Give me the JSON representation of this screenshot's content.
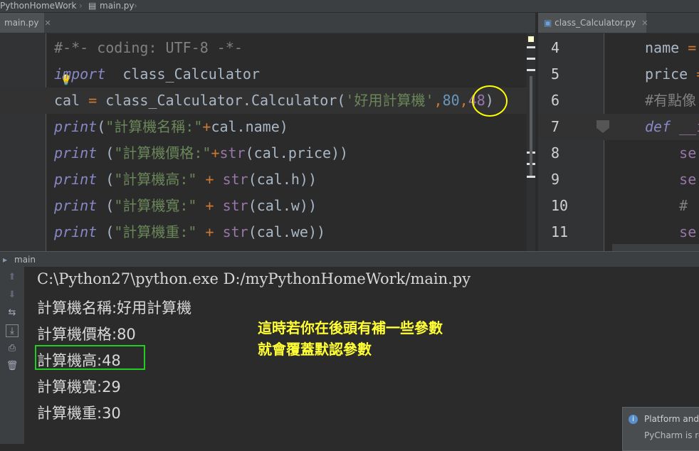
{
  "breadcrumb": {
    "project": "PythonHomeWork",
    "file": "main.py"
  },
  "editor_left": {
    "tab": {
      "label": "main.py"
    },
    "lines": [
      {
        "tokens": [
          {
            "t": "#-*- coding: UTF-8 -*-",
            "c": "cmt"
          }
        ]
      },
      {
        "tokens": [
          {
            "t": "import",
            "c": "it"
          },
          {
            "t": "  class_Calculator",
            "c": ""
          }
        ]
      },
      {
        "tokens": [
          {
            "t": "cal ",
            "c": ""
          },
          {
            "t": "=",
            "c": "op"
          },
          {
            "t": " class_Calculator.Calculator(",
            "c": ""
          },
          {
            "t": "'好用計算機'",
            "c": "str"
          },
          {
            "t": ",",
            "c": "kw"
          },
          {
            "t": "80",
            "c": "num"
          },
          {
            "t": ",",
            "c": "kw"
          },
          {
            "t": "48",
            "c": "purple"
          },
          {
            "t": ")",
            "c": ""
          }
        ]
      },
      {
        "tokens": [
          {
            "t": "print",
            "c": "it"
          },
          {
            "t": "(",
            "c": ""
          },
          {
            "t": "\"計算機名稱:\"",
            "c": "str"
          },
          {
            "t": "+",
            "c": "op"
          },
          {
            "t": "cal.name)",
            "c": ""
          }
        ]
      },
      {
        "tokens": [
          {
            "t": "print",
            "c": "it"
          },
          {
            "t": " (",
            "c": ""
          },
          {
            "t": "\"計算機價格:\"",
            "c": "str"
          },
          {
            "t": "+",
            "c": "op"
          },
          {
            "t": "str",
            "c": "purple"
          },
          {
            "t": "(cal.price))",
            "c": ""
          }
        ]
      },
      {
        "tokens": [
          {
            "t": "print",
            "c": "it"
          },
          {
            "t": " (",
            "c": ""
          },
          {
            "t": "\"計算機高:\"",
            "c": "str"
          },
          {
            "t": " + ",
            "c": "op"
          },
          {
            "t": "str",
            "c": "purple"
          },
          {
            "t": "(cal.h))",
            "c": ""
          }
        ]
      },
      {
        "tokens": [
          {
            "t": "print",
            "c": "it"
          },
          {
            "t": " (",
            "c": ""
          },
          {
            "t": "\"計算機寬:\"",
            "c": "str"
          },
          {
            "t": " + ",
            "c": "op"
          },
          {
            "t": "str",
            "c": "purple"
          },
          {
            "t": "(cal.w))",
            "c": ""
          }
        ]
      },
      {
        "tokens": [
          {
            "t": "print",
            "c": "it"
          },
          {
            "t": " (",
            "c": ""
          },
          {
            "t": "\"計算機重:\"",
            "c": "str"
          },
          {
            "t": " + ",
            "c": "op"
          },
          {
            "t": "str",
            "c": "purple"
          },
          {
            "t": "(cal.we))",
            "c": ""
          }
        ]
      }
    ]
  },
  "editor_right": {
    "tab": {
      "label": "class_Calculator.py"
    },
    "line_numbers": [
      "4",
      "5",
      "6",
      "7",
      "8",
      "9",
      "10",
      "11"
    ],
    "lines": [
      {
        "tokens": [
          {
            "t": "name ",
            "c": ""
          },
          {
            "t": "=",
            "c": "op"
          }
        ]
      },
      {
        "tokens": [
          {
            "t": "price ",
            "c": ""
          },
          {
            "t": "=",
            "c": "op"
          }
        ]
      },
      {
        "tokens": [
          {
            "t": "#有點像",
            "c": "cmt"
          }
        ]
      },
      {
        "tokens": [
          {
            "t": "def",
            "c": "it"
          },
          {
            "t": " __i",
            "c": "purple"
          }
        ]
      },
      {
        "tokens": [
          {
            "t": "    se",
            "c": "purple"
          }
        ]
      },
      {
        "tokens": [
          {
            "t": "    se",
            "c": "purple"
          }
        ]
      },
      {
        "tokens": [
          {
            "t": "    # ",
            "c": "cmt"
          }
        ]
      },
      {
        "tokens": [
          {
            "t": "    se",
            "c": "purple"
          }
        ]
      }
    ]
  },
  "run": {
    "title": "main",
    "output": [
      "C:\\Python27\\python.exe D:/myPythonHomeWork/main.py",
      "計算機名稱:好用計算機",
      "計算機價格:80",
      "計算機高:48",
      "計算機寬:29",
      "計算機重:30"
    ],
    "annotation": [
      "這時若你在後頭有補一些參數",
      "就會覆蓋默認參數"
    ]
  },
  "notification": {
    "title": "Platform and",
    "body": "PyCharm is re"
  },
  "colors": {
    "highlight_circle": "#ffff00",
    "highlight_box": "#22cc22",
    "annotation_text": "#ffff33"
  }
}
